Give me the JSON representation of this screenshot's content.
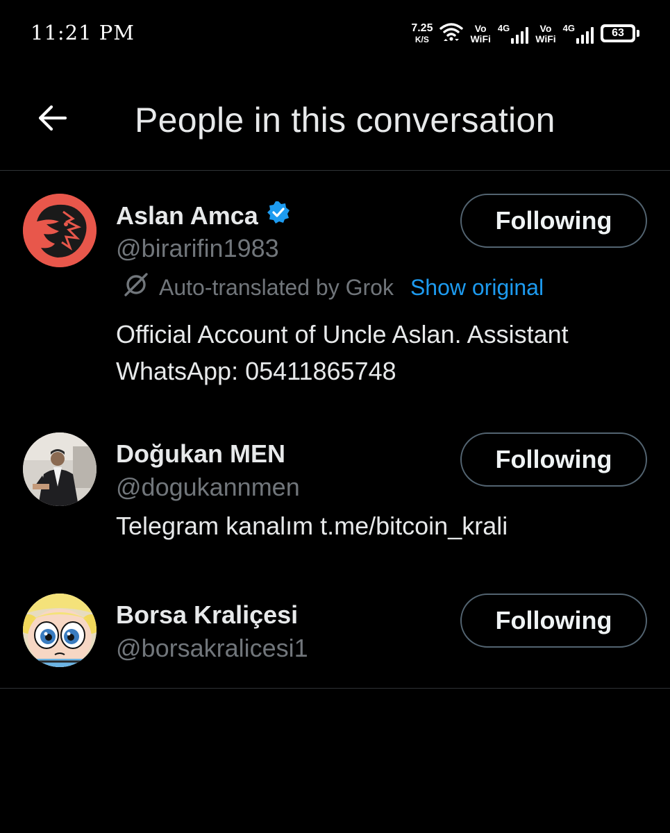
{
  "status_bar": {
    "time": "11:21 PM",
    "net_speed_value": "7.25",
    "net_speed_unit": "K/S",
    "sim1_volte_top": "Vo",
    "sim1_volte_bottom": "WiFi",
    "sim1_network": "4G",
    "sim2_volte_top": "Vo",
    "sim2_volte_bottom": "WiFi",
    "sim2_network": "4G",
    "battery_level": "63"
  },
  "header": {
    "title": "People in this conversation",
    "back_icon": "arrow-left-icon"
  },
  "people": [
    {
      "name": "Aslan Amca",
      "verified": true,
      "handle": "@birarifin1983",
      "button_label": "Following",
      "translation": {
        "label": "Auto-translated by Grok",
        "link": "Show original",
        "icon": "grok-icon"
      },
      "bio_lines": [
        "Official Account of Uncle Aslan. Assistant",
        "WhatsApp: 05411865748"
      ],
      "avatar_color": "#e8574b"
    },
    {
      "name": "Doğukan MEN",
      "verified": false,
      "handle": "@dogukannmen",
      "button_label": "Following",
      "bio_lines": [
        "Telegram kanalım t.me/bitcoin_krali"
      ]
    },
    {
      "name": "Borsa Kraliçesi",
      "verified": false,
      "handle": "@borsakralicesi1",
      "button_label": "Following",
      "bio_lines": []
    }
  ],
  "colors": {
    "background": "#000000",
    "primary_text": "#e7e9ea",
    "secondary_text": "#71767b",
    "link": "#1d9bf0",
    "divider": "#2f3336",
    "verified_badge": "#1d9bf0"
  }
}
